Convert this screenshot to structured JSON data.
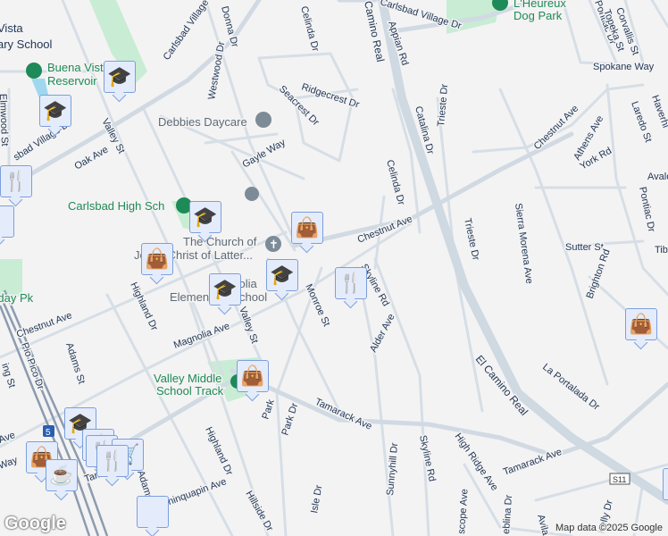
{
  "streets": [
    "Vista",
    "ary School",
    "Carlsbad Village Dr",
    "sbad Village Dr",
    "Carlsbad Village Dr",
    "Donna Dr",
    "Westwood Dr",
    "Celinda Dr",
    "Ridgecrest Dr",
    "Seacrest Dr",
    "Gayle Way",
    "Oak Ave",
    "Valley St",
    "Elmwood St",
    "Chestnut Ave",
    "Chestnut Ave",
    "Chestnut Ave",
    "Monroe St",
    "Skyline Rd",
    "Skyline Rd",
    "Alder Ave",
    "Magnolia Ave",
    "Valley St",
    "Highland Dr",
    "Highland Dr",
    "Adams St",
    "Adams St",
    "Pio Pico Dr",
    "Park Dr",
    "Tamarack Ave",
    "Tamarack Ave",
    "Tamarack Ave",
    "Chinquapin Ave",
    "Hillside Dr",
    "Isle Dr",
    "Sunnyhill Dr",
    "High Ridge Ave",
    "scope Ave",
    "eblina Dr",
    "Avila",
    "Kelly Dr",
    "El Camino Real",
    "Camino Real",
    "La Portalada Dr",
    "Appian Rd",
    "Catalina Dr",
    "Trieste Dr",
    "Trieste Dr",
    "Celinda Dr",
    "Sierra Morena Ave",
    "Athens Ave",
    "York Rd",
    "Laredo St",
    "Haverhi",
    "Spokane Way",
    "Pontiac Dr",
    "Topeka St",
    "Corvallis St",
    "Pontiac Dr",
    "Sutter St",
    "Brighton Rd",
    "Tib",
    "Avalo",
    "ing St",
    "Ave",
    "Way",
    "Park"
  ],
  "pois": {
    "reservoir": [
      "Buena Vista",
      "Reservoir"
    ],
    "daycare": "Debbies Daycare",
    "high_school": "Carlsbad High Sch",
    "church": [
      "The Church of",
      "Jesus Christ of Latter..."
    ],
    "magnolia": [
      "Magnolia",
      "Elementary School"
    ],
    "track": [
      "Valley Middle",
      "School Track"
    ],
    "dog_park": [
      "L'Heureux",
      "Dog Park"
    ],
    "holiday": "Holiday Pk"
  },
  "shields": {
    "i5": "5",
    "s11": "S11"
  },
  "attribution": "Map data ©2025 Google",
  "logo": "Google",
  "colors": {
    "park": "#c8ecd4",
    "poi_text": "#1e8a57",
    "marker_bg": "#e4ecfb",
    "marker_icon": "#0e4769"
  }
}
